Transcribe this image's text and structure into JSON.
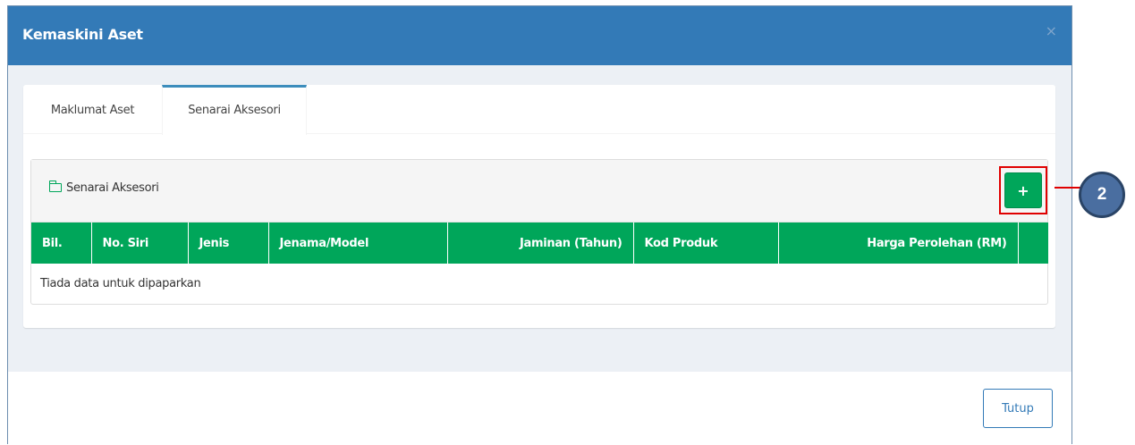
{
  "modal": {
    "title": "Kemaskini Aset",
    "close": "×"
  },
  "tabs": [
    {
      "label": "Maklumat Aset"
    },
    {
      "label": "Senarai Aksesori"
    }
  ],
  "panel": {
    "title": "Senarai Aksesori",
    "add_label": "+"
  },
  "table": {
    "columns": [
      "Bil.",
      "No. Siri",
      "Jenis",
      "Jenama/Model",
      "Jaminan (Tahun)",
      "Kod Produk",
      "Harga Perolehan (RM)"
    ],
    "empty_text": "Tiada data untuk dipaparkan"
  },
  "footer": {
    "close_label": "Tutup"
  },
  "callout": {
    "number": "2"
  },
  "colors": {
    "header": "#337ab7",
    "accent": "#00a65a",
    "highlight": "#e00000"
  }
}
